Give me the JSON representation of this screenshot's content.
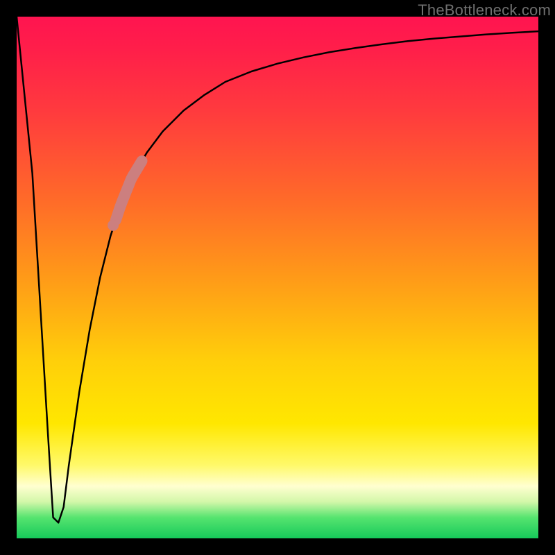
{
  "watermark": "TheBottleneck.com",
  "chart_data": {
    "type": "line",
    "title": "",
    "xlabel": "",
    "ylabel": "",
    "xlim": [
      0,
      100
    ],
    "ylim": [
      0,
      100
    ],
    "grid": false,
    "legend": false,
    "series": [
      {
        "name": "bottleneck-curve",
        "x": [
          0,
          3,
          6,
          7,
          8,
          9,
          10,
          12,
          14,
          16,
          18,
          20,
          22,
          25,
          28,
          32,
          36,
          40,
          45,
          50,
          55,
          60,
          65,
          70,
          75,
          80,
          85,
          90,
          95,
          100
        ],
        "y": [
          100,
          70,
          20,
          4,
          3,
          6,
          14,
          28,
          40,
          50,
          58,
          64,
          69,
          74,
          78,
          82,
          85,
          87.5,
          89.5,
          91,
          92.2,
          93.2,
          94,
          94.7,
          95.3,
          95.8,
          96.2,
          96.6,
          96.9,
          97.2
        ]
      }
    ],
    "annotations": [
      {
        "name": "highlight-segment",
        "x_range": [
          19,
          24
        ],
        "y_range": [
          62,
          72
        ]
      },
      {
        "name": "highlight-dot",
        "x": 18.5,
        "y": 60
      }
    ],
    "colors": {
      "curve": "#000000",
      "highlight": "#cc7f7f",
      "gradient_top": "#ff1450",
      "gradient_mid": "#ffe700",
      "gradient_bottom": "#16c95a"
    }
  }
}
